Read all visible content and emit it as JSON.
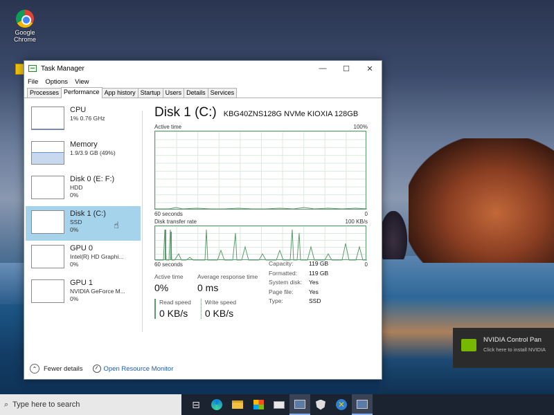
{
  "desktop": {
    "icon_label": "Google Chrome"
  },
  "window": {
    "title": "Task Manager",
    "minimize_glyph": "—",
    "maximize_glyph": "☐",
    "close_glyph": "✕",
    "menu": [
      "File",
      "Options",
      "View"
    ],
    "tabs": [
      "Processes",
      "Performance",
      "App history",
      "Startup",
      "Users",
      "Details",
      "Services"
    ],
    "active_tab": "Performance"
  },
  "sidebar": {
    "items": [
      {
        "name": "CPU",
        "line1": "1% 0.76 GHz",
        "line2": "",
        "fill": 0.01
      },
      {
        "name": "Memory",
        "line1": "1.9/3.9 GB (49%)",
        "line2": "",
        "fill": 0.49
      },
      {
        "name": "Disk 0 (E: F:)",
        "line1": "HDD",
        "line2": "0%",
        "fill": 0
      },
      {
        "name": "Disk 1 (C:)",
        "line1": "SSD",
        "line2": "0%",
        "fill": 0
      },
      {
        "name": "GPU 0",
        "line1": "Intel(R) HD Graphi...",
        "line2": "0%",
        "fill": 0
      },
      {
        "name": "GPU 1",
        "line1": "NVIDIA GeForce M...",
        "line2": "0%",
        "fill": 0
      }
    ],
    "selected_index": 3
  },
  "main": {
    "title": "Disk 1 (C:)",
    "model": "KBG40ZNS128G NVMe KIOXIA 128GB",
    "graph1": {
      "label": "Active time",
      "max_label": "100%",
      "time_label": "60 seconds",
      "min_label": "0"
    },
    "graph2": {
      "label": "Disk transfer rate",
      "max_label": "100 KB/s",
      "time_label": "60 seconds",
      "min_label": "0"
    },
    "active_time_label": "Active time",
    "active_time_value": "0%",
    "response_label": "Average response time",
    "response_value": "0 ms",
    "read_label": "Read speed",
    "read_value": "0 KB/s",
    "write_label": "Write speed",
    "write_value": "0 KB/s",
    "properties": [
      {
        "key": "Capacity:",
        "value": "119 GB"
      },
      {
        "key": "Formatted:",
        "value": "119 GB"
      },
      {
        "key": "System disk:",
        "value": "Yes"
      },
      {
        "key": "Page file:",
        "value": "Yes"
      },
      {
        "key": "Type:",
        "value": "SSD"
      }
    ]
  },
  "footer": {
    "fewer_details": "Fewer details",
    "resource_monitor": "Open Resource Monitor"
  },
  "notification": {
    "title": "NVIDIA Control Pan",
    "subtitle": "Click here to install NVIDIA"
  },
  "taskbar": {
    "search_placeholder": "Type here to search"
  },
  "colors": {
    "graph_line": "#5b9a6c",
    "selected_item": "#a6d3ec",
    "link": "#1a5fb4"
  }
}
